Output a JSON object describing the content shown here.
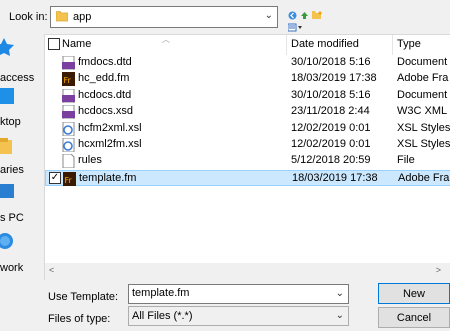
{
  "lookin": {
    "label": "Look in:",
    "folder": "app"
  },
  "places": [
    {
      "label": "access",
      "icon": "star-icon"
    },
    {
      "label": "ktop",
      "icon": "desktop-icon"
    },
    {
      "label": "aries",
      "icon": "libraries-icon"
    },
    {
      "label": "s PC",
      "icon": "computer-icon"
    },
    {
      "label": "work",
      "icon": "network-icon"
    }
  ],
  "columns": {
    "name": "Name",
    "date": "Date modified",
    "type": "Type"
  },
  "files": [
    {
      "name": "fmdocs.dtd",
      "date": "30/10/2018 5:16",
      "type": "Document",
      "icon": "dtd-file-icon",
      "selected": false
    },
    {
      "name": "hc_edd.fm",
      "date": "18/03/2019 17:38",
      "type": "Adobe Fra",
      "icon": "framemaker-file-icon",
      "selected": false
    },
    {
      "name": "hcdocs.dtd",
      "date": "30/10/2018 5:16",
      "type": "Document",
      "icon": "dtd-file-icon",
      "selected": false
    },
    {
      "name": "hcdocs.xsd",
      "date": "23/11/2018 2:44",
      "type": "W3C XML",
      "icon": "xsd-file-icon",
      "selected": false
    },
    {
      "name": "hcfm2xml.xsl",
      "date": "12/02/2019 0:01",
      "type": "XSL Styles",
      "icon": "xsl-file-icon",
      "selected": false
    },
    {
      "name": "hcxml2fm.xsl",
      "date": "12/02/2019 0:01",
      "type": "XSL Styles",
      "icon": "xsl-file-icon",
      "selected": false
    },
    {
      "name": "rules",
      "date": "5/12/2018 20:59",
      "type": "File",
      "icon": "blank-file-icon",
      "selected": false
    },
    {
      "name": "template.fm",
      "date": "18/03/2019 17:38",
      "type": "Adobe Fra",
      "icon": "framemaker-file-icon",
      "selected": true
    }
  ],
  "use_template": {
    "label": "Use Template:",
    "value": "template.fm"
  },
  "file_type": {
    "label": "Files of type:",
    "value": "All Files (*.*)"
  },
  "buttons": {
    "new": "New",
    "cancel": "Cancel"
  },
  "colors": {
    "selection": "#cce8ff",
    "selection_border": "#99d1ff",
    "accent": "#0078d7"
  }
}
